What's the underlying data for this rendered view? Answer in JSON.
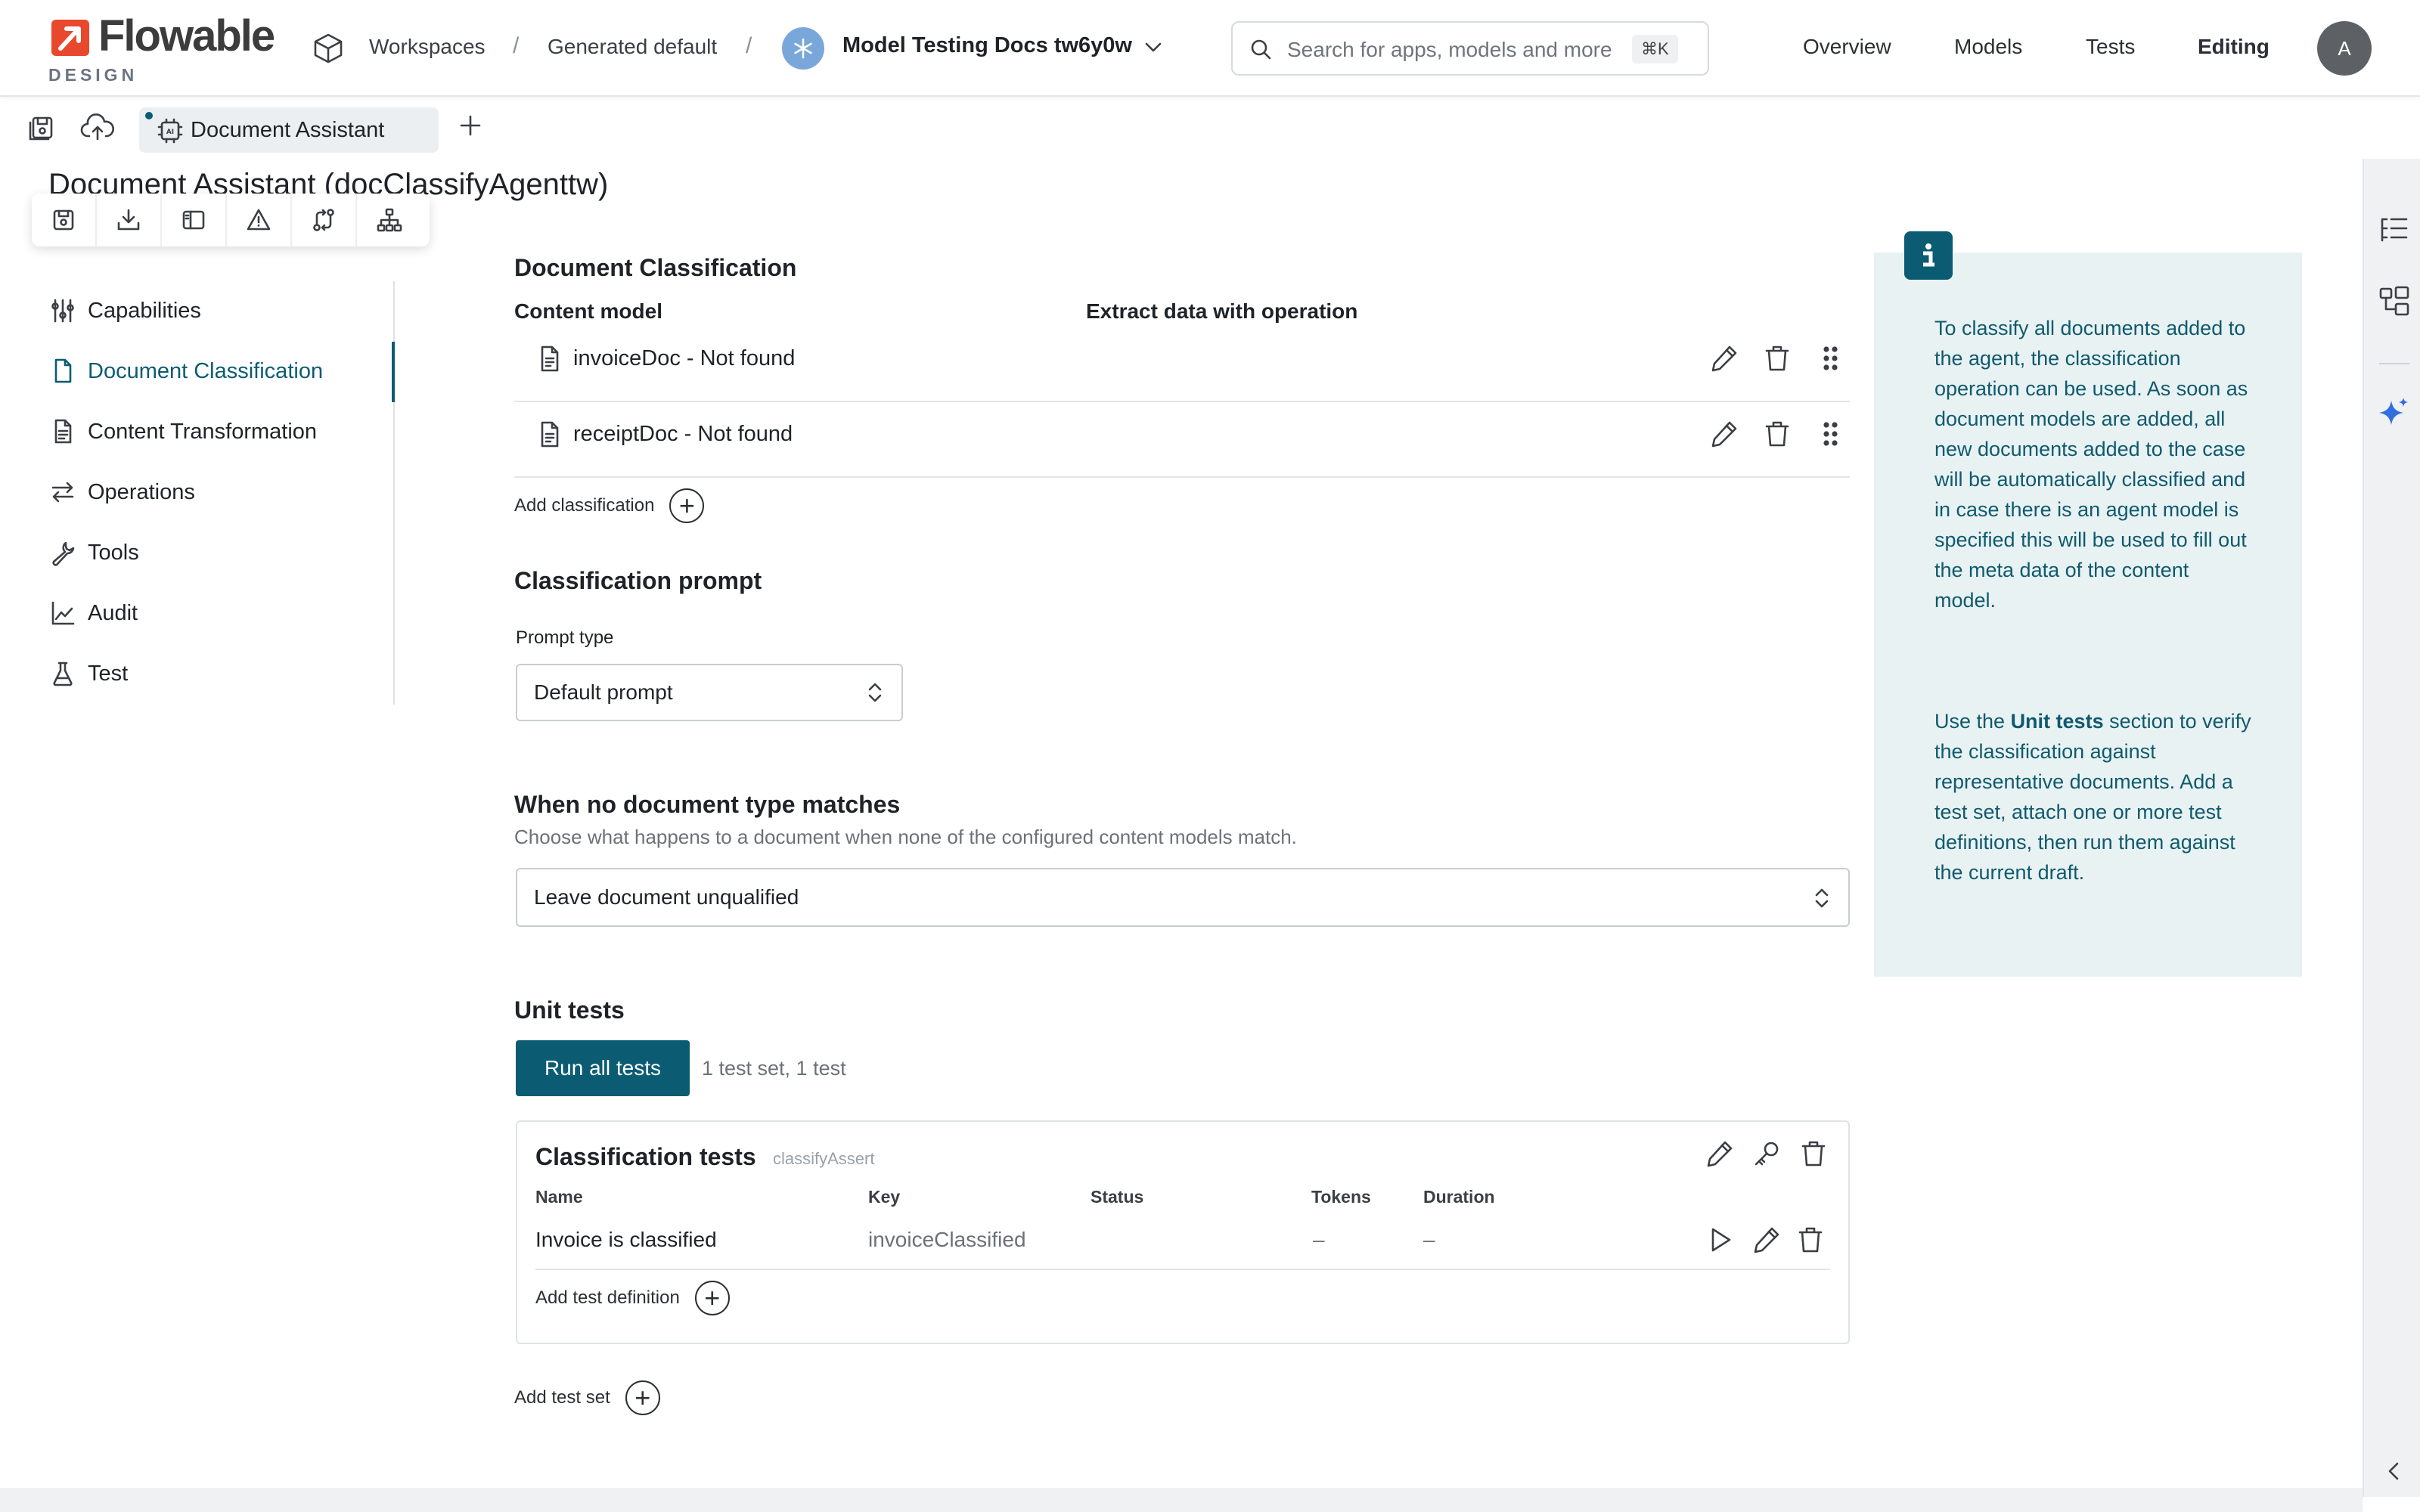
{
  "brand": {
    "name": "Flowable",
    "sub": "DESIGN",
    "accent": "#e8492d"
  },
  "breadcrumb": {
    "workspaces": "Workspaces",
    "generated": "Generated default",
    "app": "Model Testing Docs tw6y0w"
  },
  "search": {
    "placeholder": "Search for apps, models and more",
    "shortcut": "⌘K"
  },
  "topnav": {
    "overview": "Overview",
    "models": "Models",
    "tests": "Tests",
    "editing": "Editing"
  },
  "user": {
    "initial": "A"
  },
  "tabs": {
    "active": "Document Assistant"
  },
  "page": {
    "title": "Document Assistant (docClassifyAgenttw)"
  },
  "sidebar": {
    "items": [
      {
        "label": "Capabilities"
      },
      {
        "label": "Document Classification"
      },
      {
        "label": "Content Transformation"
      },
      {
        "label": "Operations"
      },
      {
        "label": "Tools"
      },
      {
        "label": "Audit"
      },
      {
        "label": "Test"
      }
    ]
  },
  "classification": {
    "title": "Document Classification",
    "col_model": "Content model",
    "col_operation": "Extract data with operation",
    "rows": [
      {
        "name": "invoiceDoc - Not found"
      },
      {
        "name": "receiptDoc - Not found"
      }
    ],
    "add_label": "Add classification"
  },
  "prompt": {
    "title": "Classification prompt",
    "type_label": "Prompt type",
    "type_value": "Default prompt"
  },
  "nomatch": {
    "title": "When no document type matches",
    "description": "Choose what happens to a document when none of the configured content models match.",
    "value": "Leave document unqualified"
  },
  "unit_tests": {
    "title": "Unit tests",
    "run_all": "Run all tests",
    "summary": "1 test set, 1 test",
    "set": {
      "name": "Classification tests",
      "key": "classifyAssert",
      "columns": {
        "name": "Name",
        "key": "Key",
        "status": "Status",
        "tokens": "Tokens",
        "duration": "Duration"
      },
      "rows": [
        {
          "name": "Invoice is classified",
          "key": "invoiceClassified",
          "status": "",
          "tokens": "–",
          "duration": "–"
        }
      ],
      "add_definition": "Add test definition"
    },
    "add_set": "Add test set"
  },
  "info": {
    "p1": "To classify all documents added to the agent, the classification operation can be used. As soon as document models are added, all new documents added to the case will be automatically classified and in case there is an agent model is specified this will be used to fill out the meta data of the content model.",
    "p2_before": "Use the ",
    "p2_bold": "Unit tests",
    "p2_after": " section to verify the classification against representative documents. Add a test set, attach one or more test definitions, then run them against the current draft."
  },
  "colors": {
    "primary": "#0b5c73",
    "info_bg": "#e9f2f3",
    "ai": "#2f6fe0"
  }
}
